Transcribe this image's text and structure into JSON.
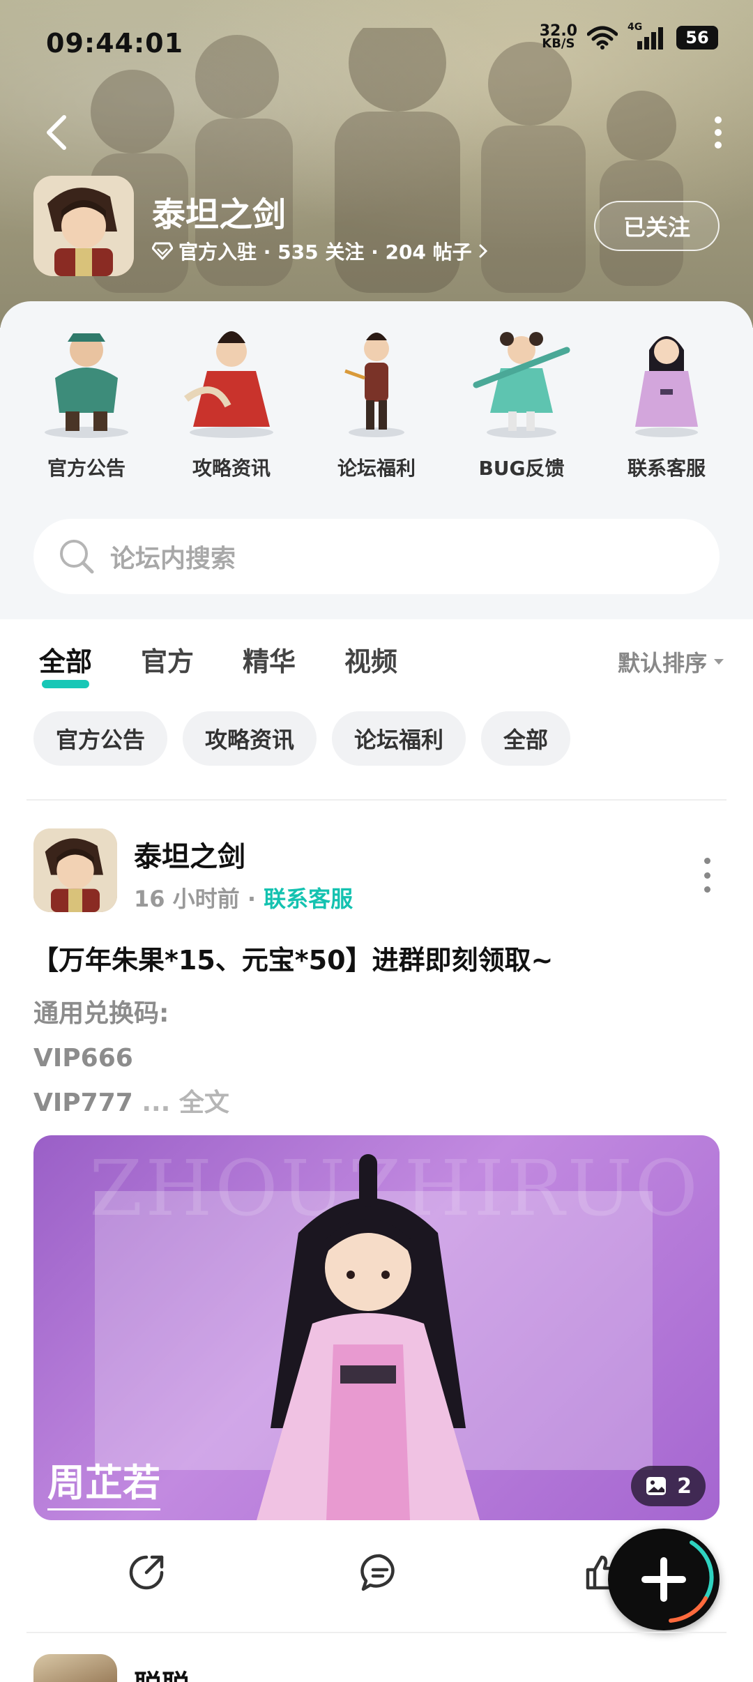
{
  "status_bar": {
    "time": "09:44:01",
    "net_speed_value": "32.0",
    "net_speed_unit": "KB/S",
    "network": "4G",
    "battery": "56"
  },
  "header": {
    "title": "泰坦之剑",
    "meta": "官方入驻 · 535 关注 · 204 帖子",
    "follow_label": "已关注"
  },
  "categories": [
    {
      "label": "官方公告"
    },
    {
      "label": "攻略资讯"
    },
    {
      "label": "论坛福利"
    },
    {
      "label": "BUG反馈"
    },
    {
      "label": "联系客服"
    }
  ],
  "search": {
    "placeholder": "论坛内搜索"
  },
  "tabs": [
    {
      "label": "全部",
      "active": true
    },
    {
      "label": "官方"
    },
    {
      "label": "精华"
    },
    {
      "label": "视频"
    }
  ],
  "sort_label": "默认排序",
  "chips": [
    "官方公告",
    "攻略资讯",
    "论坛福利",
    "全部"
  ],
  "post": {
    "author": "泰坦之剑",
    "time": "16 小时前",
    "separator": " · ",
    "category": "联系客服",
    "title": "【万年朱果*15、元宝*50】进群即刻领取~",
    "lines": [
      "通用兑换码:",
      "VIP666",
      "VIP777"
    ],
    "ellipsis": " ... 全文",
    "image_watermark": "ZHOUZHIRUO",
    "image_caption": "周芷若",
    "image_count": "2"
  },
  "next_post": {
    "author": "聪聪"
  },
  "colors": {
    "accent": "#17c7b6",
    "header_bg": "#a29c7e",
    "panel_bg": "#f4f6f8",
    "image_purple": "#a566d0"
  }
}
